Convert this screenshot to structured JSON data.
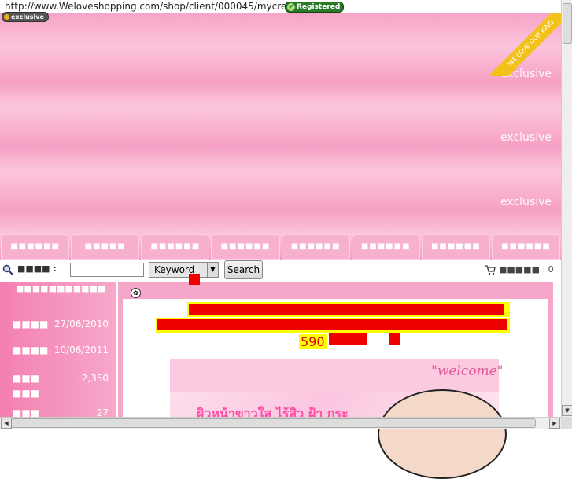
{
  "url_bar": {
    "url": "http://www.Weloveshopping.com/shop/client/000045/mycream",
    "badge": "Registered"
  },
  "tag": {
    "label": "exclusive"
  },
  "banner": {
    "band_label": "exclusive",
    "ribbon": "WE LOVE OUR KING"
  },
  "nav": {
    "tabs": [
      "■■■■■■",
      "■■■■■",
      "■■■■■■",
      "■■■■■■",
      "■■■■■■",
      "■■■■■■",
      "■■■■■■",
      "■■■■■■"
    ]
  },
  "search": {
    "label": "■■■■ :",
    "keyword_option": "Keyword",
    "button": "Search"
  },
  "cart": {
    "label": "■■■■■ : 0"
  },
  "sidebar": {
    "title": "■■■■■■■■■■■",
    "rows": [
      {
        "key": "■■■■",
        "value": "27/06/2010"
      },
      {
        "key": "■■■■",
        "value": "10/06/2011"
      },
      {
        "key": "■■■",
        "value": "2,350"
      },
      {
        "key": "■■■",
        "value": ""
      },
      {
        "key": "■■■",
        "value": "27"
      }
    ]
  },
  "main": {
    "price": "590",
    "welcome": "\"welcome\"",
    "thai": "ผิวหน้าขาวใส ไร้สิว ฝ้า กระ"
  },
  "colors": {
    "pink": "#f7a3c6",
    "highlight": "#ffff00",
    "censor_red": "#e00000"
  }
}
